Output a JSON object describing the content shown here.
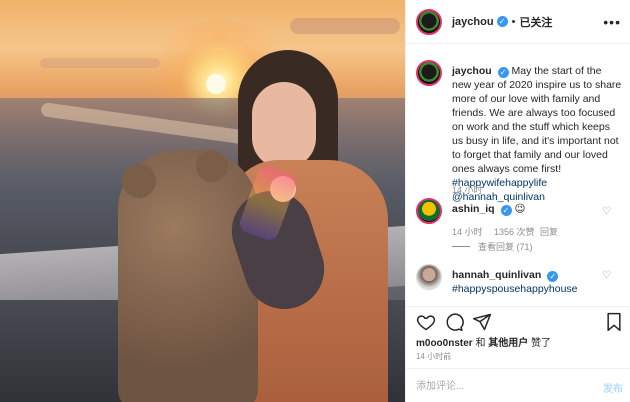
{
  "header": {
    "username": "jaychou",
    "dot": "•",
    "follow_label": "已关注",
    "more": "•••"
  },
  "caption": {
    "username": "jaychou",
    "text": "May the start of the new year of 2020 inspire us to share more of our love with family and friends. We are always too focused on work and the stuff which keeps us busy in life, and it's important not to forget that family and our loved ones always come first!",
    "hashtag": "#happywifehappylife",
    "mention": "@hannah_quinlivan",
    "time": "14 小时"
  },
  "comments": [
    {
      "username": "ashin_iq",
      "text": "😉",
      "time": "14 小时",
      "likes": "1356 次赞",
      "reply": "回复",
      "view_replies": "查看回复 (71)"
    },
    {
      "username": "hannah_quinlivan",
      "hashtag": "#happyspousehappyhouse"
    }
  ],
  "likes": {
    "user": "m0oo0nster",
    "and": "和",
    "others": "其他用户",
    "liked": "赞了"
  },
  "post_time": "14 小时前",
  "add_comment": {
    "placeholder": "添加评论...",
    "post_label": "发布"
  },
  "colors": {
    "verified": "#3897f0",
    "link": "#003569",
    "story_ring": "#e1306c"
  }
}
